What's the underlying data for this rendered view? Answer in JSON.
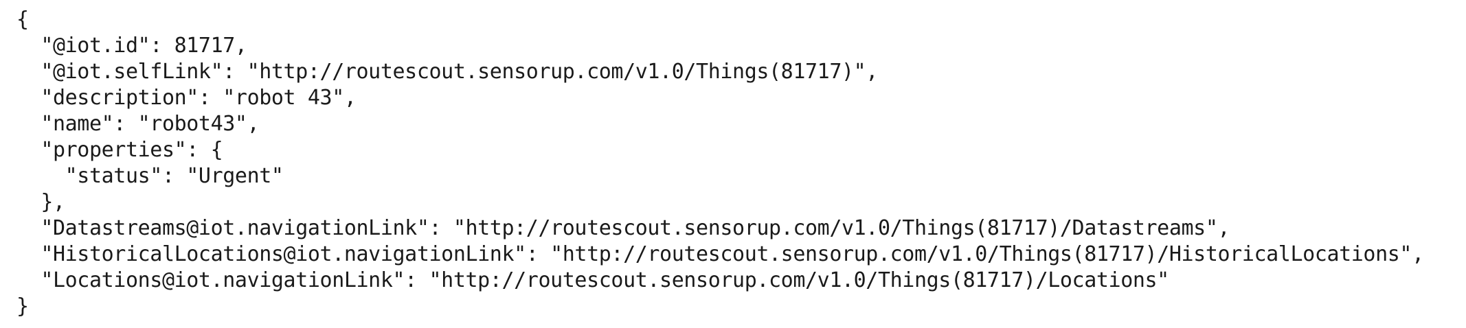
{
  "lines": [
    "{",
    "  \"@iot.id\": 81717,",
    "  \"@iot.selfLink\": \"http://routescout.sensorup.com/v1.0/Things(81717)\",",
    "  \"description\": \"robot 43\",",
    "  \"name\": \"robot43\",",
    "  \"properties\": {",
    "    \"status\": \"Urgent\"",
    "  },",
    "  \"Datastreams@iot.navigationLink\": \"http://routescout.sensorup.com/v1.0/Things(81717)/Datastreams\",",
    "  \"HistoricalLocations@iot.navigationLink\": \"http://routescout.sensorup.com/v1.0/Things(81717)/HistoricalLocations\",",
    "  \"Locations@iot.navigationLink\": \"http://routescout.sensorup.com/v1.0/Things(81717)/Locations\"",
    "}"
  ]
}
